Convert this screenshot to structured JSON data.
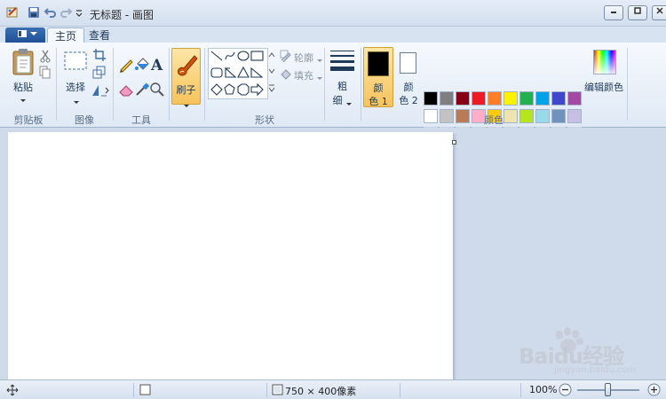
{
  "title": "无标题 - 画图",
  "tabs": {
    "home": "主页",
    "view": "查看"
  },
  "groups": {
    "clipboard": "剪贴板",
    "image": "图像",
    "tools": "工具",
    "shapes": "形状",
    "colors": "颜色"
  },
  "buttons": {
    "paste": "粘贴",
    "select": "选择",
    "brushes": "刷子",
    "outline": "轮廓",
    "fill": "填充",
    "size_line1": "粗",
    "size_line2": "细",
    "color1_line1": "颜",
    "color1_line2": "色 1",
    "color2_line1": "颜",
    "color2_line2": "色 2",
    "edit_colors": "编辑颜色"
  },
  "palette_row1": [
    "#000000",
    "#7f7f7f",
    "#880015",
    "#ed1c24",
    "#ff7f27",
    "#fff200",
    "#22b14c",
    "#00a2e8",
    "#3f48cc",
    "#a349a4"
  ],
  "palette_row2": [
    "#ffffff",
    "#c3c3c3",
    "#b97a57",
    "#ffaec9",
    "#ffc90e",
    "#efe4b0",
    "#b5e61d",
    "#99d9ea",
    "#7092be",
    "#c8bfe7"
  ],
  "primary_color": "#000000",
  "secondary_color": "#ffffff",
  "status": {
    "image_size": "750 × 400像素",
    "zoom": "100%"
  },
  "zoom_percent": 100,
  "watermark": "Baidu经验",
  "watermark_sub": "jingyan.baidu.com"
}
